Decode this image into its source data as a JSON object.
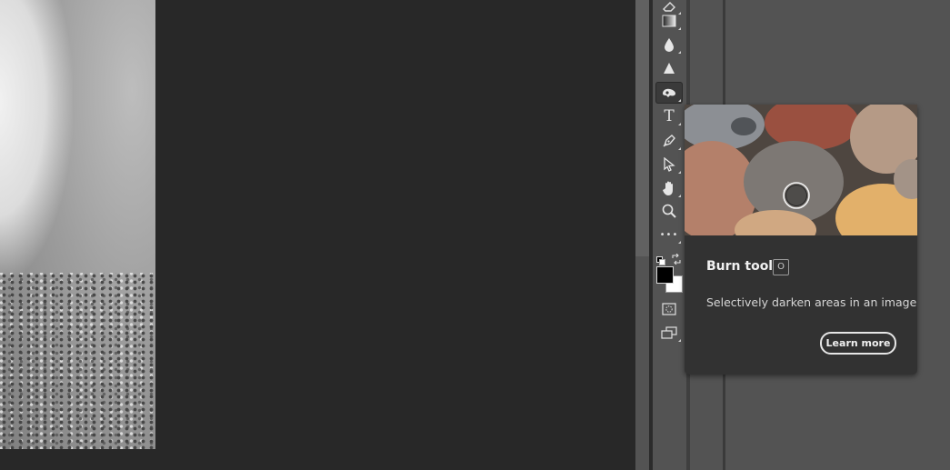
{
  "flyout": {
    "title": "Burn tool",
    "shortcut": "O",
    "description": "Selectively darken areas in an image",
    "learn_more": "Learn more"
  },
  "toolbar": {
    "tools": [
      {
        "id": "eraser",
        "icon": "eraser-icon"
      },
      {
        "id": "gradient",
        "icon": "gradient-icon"
      },
      {
        "id": "blur",
        "icon": "blur-drop-icon"
      },
      {
        "id": "sharpen",
        "icon": "sharpen-triangle-icon"
      },
      {
        "id": "burn",
        "icon": "burn-icon",
        "active": true
      },
      {
        "id": "type",
        "icon": "type-icon",
        "glyph": "T"
      },
      {
        "id": "pen",
        "icon": "pen-icon"
      },
      {
        "id": "path-selection",
        "icon": "path-selection-icon"
      },
      {
        "id": "hand",
        "icon": "hand-icon"
      },
      {
        "id": "zoom",
        "icon": "zoom-icon"
      },
      {
        "id": "more",
        "icon": "more-tools-icon",
        "glyph": "•••"
      }
    ],
    "foreground_color": "#000000",
    "background_color": "#ffffff"
  },
  "colors": {
    "workspace": "#282828",
    "panel": "#535353",
    "flyout": "#323232"
  }
}
